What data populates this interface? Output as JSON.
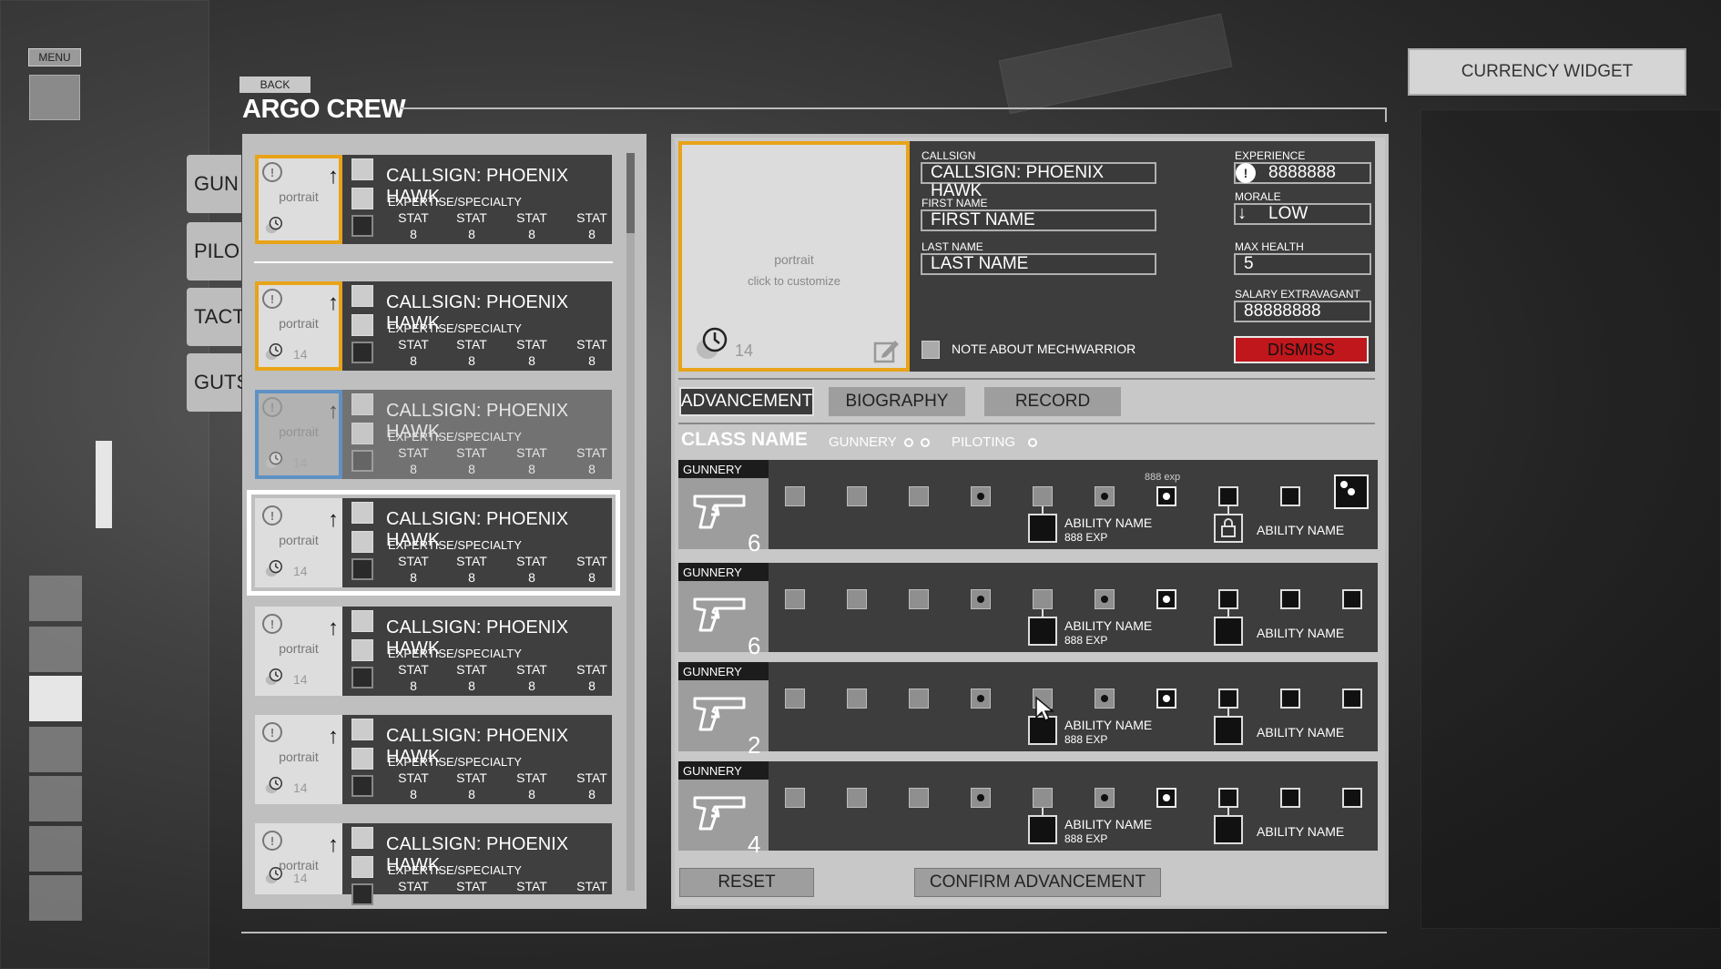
{
  "menu": {
    "label": "MENU"
  },
  "back": {
    "label": "BACK"
  },
  "title": "ARGO CREW",
  "currency": {
    "label": "CURRENCY WIDGET"
  },
  "category_tabs": [
    "GUN",
    "PILO",
    "TACT",
    "GUTS"
  ],
  "roster": [
    {
      "callsign": "CALLSIGN: PHOENIX HAWK",
      "expertise": "EXPERTISE/SPECIALTY",
      "portrait": "portrait",
      "level": "",
      "stat_labels": [
        "STAT",
        "STAT",
        "STAT",
        "STAT"
      ],
      "stat_values": [
        "8",
        "8",
        "8",
        "8"
      ]
    },
    {
      "callsign": "CALLSIGN: PHOENIX HAWK",
      "expertise": "EXPERTISE/SPECIALTY",
      "portrait": "portrait",
      "level": "14",
      "stat_labels": [
        "STAT",
        "STAT",
        "STAT",
        "STAT"
      ],
      "stat_values": [
        "8",
        "8",
        "8",
        "8"
      ]
    },
    {
      "callsign": "CALLSIGN: PHOENIX HAWK",
      "expertise": "EXPERTISE/SPECIALTY",
      "portrait": "portrait",
      "level": "14",
      "stat_labels": [
        "STAT",
        "STAT",
        "STAT",
        "STAT"
      ],
      "stat_values": [
        "8",
        "8",
        "8",
        "8"
      ]
    },
    {
      "callsign": "CALLSIGN: PHOENIX HAWK",
      "expertise": "EXPERTISE/SPECIALTY",
      "portrait": "portrait",
      "level": "14",
      "stat_labels": [
        "STAT",
        "STAT",
        "STAT",
        "STAT"
      ],
      "stat_values": [
        "8",
        "8",
        "8",
        "8"
      ]
    },
    {
      "callsign": "CALLSIGN: PHOENIX HAWK",
      "expertise": "EXPERTISE/SPECIALTY",
      "portrait": "portrait",
      "level": "14",
      "stat_labels": [
        "STAT",
        "STAT",
        "STAT",
        "STAT"
      ],
      "stat_values": [
        "8",
        "8",
        "8",
        "8"
      ]
    },
    {
      "callsign": "CALLSIGN: PHOENIX HAWK",
      "expertise": "EXPERTISE/SPECIALTY",
      "portrait": "portrait",
      "level": "14",
      "stat_labels": [
        "STAT",
        "STAT",
        "STAT",
        "STAT"
      ],
      "stat_values": [
        "8",
        "8",
        "8",
        "8"
      ]
    },
    {
      "callsign": "CALLSIGN: PHOENIX HAWK",
      "expertise": "EXPERTISE/SPECIALTY",
      "portrait": "portrait",
      "level": "14",
      "stat_labels": [
        "STAT",
        "STAT",
        "STAT",
        "STAT"
      ],
      "stat_values": [
        "",
        "",
        "",
        ""
      ]
    }
  ],
  "detail": {
    "portrait": "portrait",
    "portrait_hint": "click to customize",
    "level": "14",
    "callsign_label": "CALLSIGN",
    "callsign_value": "CALLSIGN: PHOENIX HAWK",
    "first_name_label": "FIRST NAME",
    "first_name_value": "FIRST NAME",
    "last_name_label": "LAST NAME",
    "last_name_value": "LAST NAME",
    "experience_label": "EXPERIENCE",
    "experience_value": "8888888",
    "morale_label": "MORALE",
    "morale_value": "LOW",
    "max_health_label": "MAX HEALTH",
    "max_health_value": "5",
    "salary_label": "SALARY EXTRAVAGANT",
    "salary_value": "88888888",
    "note_label": "NOTE ABOUT MECHWARRIOR",
    "dismiss_label": "DISMISS",
    "colors": {
      "dismiss": "#c0171c",
      "accent": "#e8a318",
      "selected_blue": "#1e73c8"
    }
  },
  "tabs": [
    "ADVANCEMENT",
    "BIOGRAPHY",
    "RECORD"
  ],
  "class_row": {
    "name": "CLASS NAME",
    "gunnery": "GUNNERY",
    "piloting": "PILOTING"
  },
  "skills": [
    {
      "label": "GUNNERY",
      "value": "6",
      "exp_tag": "888 exp",
      "ability1": "ABILITY NAME",
      "ability1_exp": "888 EXP",
      "ability2": "ABILITY NAME"
    },
    {
      "label": "GUNNERY",
      "value": "6",
      "exp_tag": "",
      "ability1": "ABILITY NAME",
      "ability1_exp": "888 EXP",
      "ability2": "ABILITY NAME"
    },
    {
      "label": "GUNNERY",
      "value": "2",
      "exp_tag": "",
      "ability1": "ABILITY NAME",
      "ability1_exp": "888 EXP",
      "ability2": "ABILITY NAME"
    },
    {
      "label": "GUNNERY",
      "value": "4",
      "exp_tag": "",
      "ability1": "ABILITY NAME",
      "ability1_exp": "888 EXP",
      "ability2": "ABILITY NAME"
    }
  ],
  "buttons": {
    "reset": "RESET",
    "confirm": "CONFIRM ADVANCEMENT"
  }
}
